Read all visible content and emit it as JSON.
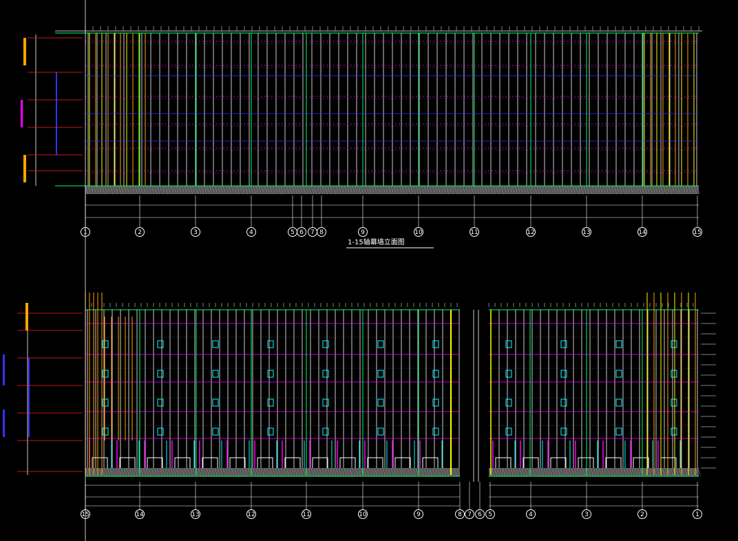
{
  "drawing": {
    "top_title": "1-15轴幕墙立面图",
    "top_axis_labels": [
      "1",
      "2",
      "3",
      "4",
      "5",
      "6",
      "7",
      "8",
      "9",
      "10",
      "11",
      "12",
      "13",
      "14",
      "15"
    ],
    "bottom_axis_labels": [
      "15",
      "14",
      "13",
      "12",
      "11",
      "10",
      "9",
      "8",
      "7",
      "6",
      "5",
      "4",
      "3",
      "2",
      "1"
    ]
  },
  "colors": {
    "background": "#000000",
    "mullion": "#ffffff",
    "accent_orange": "#ffa500",
    "accent_yellow": "#ffff00",
    "transom_magenta": "#ff00ff",
    "frame_green": "#00ff66",
    "brace_blue": "#3333ff",
    "panel_cyan": "#00ffff",
    "dimension_red": "#ff2020"
  }
}
